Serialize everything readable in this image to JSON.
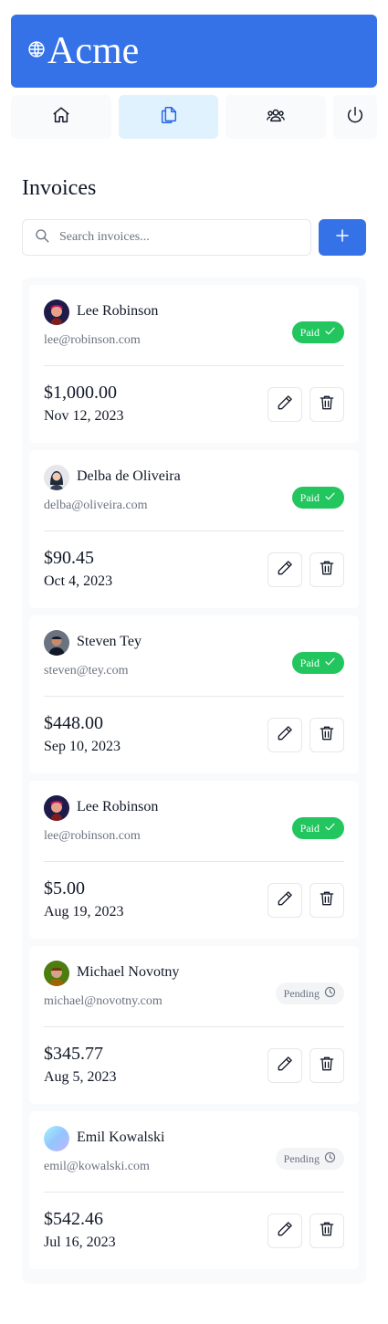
{
  "brand": {
    "name": "Acme"
  },
  "nav": [
    {
      "icon": "home-icon"
    },
    {
      "icon": "documents-icon",
      "active": true
    },
    {
      "icon": "users-icon"
    },
    {
      "icon": "power-icon"
    }
  ],
  "page": {
    "title": "Invoices"
  },
  "search": {
    "placeholder": "Search invoices..."
  },
  "invoices": [
    {
      "name": "Lee Robinson",
      "email": "lee@robinson.com",
      "amount": "$1,000.00",
      "date": "Nov 12, 2023",
      "status": "Paid",
      "avatar": "av1"
    },
    {
      "name": "Delba de Oliveira",
      "email": "delba@oliveira.com",
      "amount": "$90.45",
      "date": "Oct 4, 2023",
      "status": "Paid",
      "avatar": "av2"
    },
    {
      "name": "Steven Tey",
      "email": "steven@tey.com",
      "amount": "$448.00",
      "date": "Sep 10, 2023",
      "status": "Paid",
      "avatar": "av3"
    },
    {
      "name": "Lee Robinson",
      "email": "lee@robinson.com",
      "amount": "$5.00",
      "date": "Aug 19, 2023",
      "status": "Paid",
      "avatar": "av1"
    },
    {
      "name": "Michael Novotny",
      "email": "michael@novotny.com",
      "amount": "$345.77",
      "date": "Aug 5, 2023",
      "status": "Pending",
      "avatar": "av4"
    },
    {
      "name": "Emil Kowalski",
      "email": "emil@kowalski.com",
      "amount": "$542.46",
      "date": "Jul 16, 2023",
      "status": "Pending",
      "avatar": "av5"
    }
  ],
  "colors": {
    "primary": "#3572e8",
    "paid": "#22c55e",
    "pending_bg": "#f3f4f6",
    "nav_active_bg": "#e0f2fe"
  }
}
